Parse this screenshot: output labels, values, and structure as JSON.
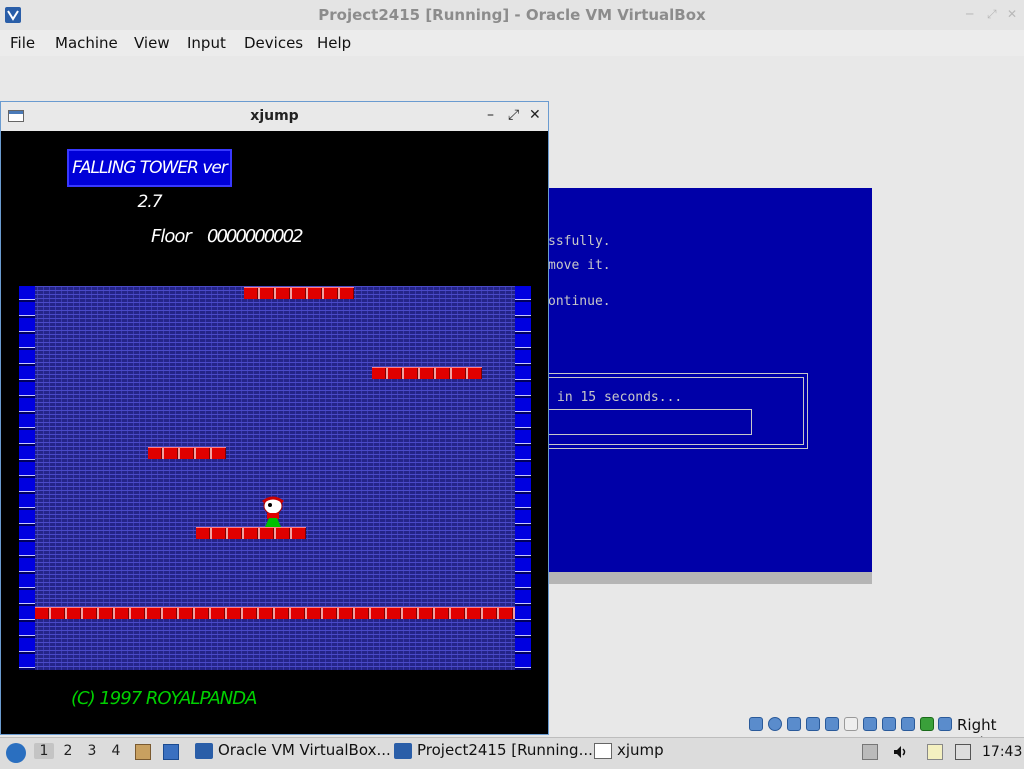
{
  "host": {
    "title": "Project2415 [Running] - Oracle VM VirtualBox",
    "menu": [
      "File",
      "Machine",
      "View",
      "Input",
      "Devices",
      "Help"
    ],
    "right_ctrl": "Right Ctrl"
  },
  "guest": {
    "lines": [
      "ssfully.",
      "move it.",
      "ontinue.",
      "in 15 seconds..."
    ],
    "bg_color": "#0000a8"
  },
  "xjump": {
    "title": "xjump",
    "logo": "FALLING TOWER ver 2.7",
    "floor_label": "Floor",
    "floor_value": "0000000002",
    "copyright": "(C) 1997 ROYALPANDA"
  },
  "taskbar": {
    "workspaces": [
      "1",
      "2",
      "3",
      "4"
    ],
    "tasks": [
      "Oracle VM VirtualBox...",
      "Project2415 [Running...",
      "xjump"
    ],
    "clock": "17:43"
  }
}
